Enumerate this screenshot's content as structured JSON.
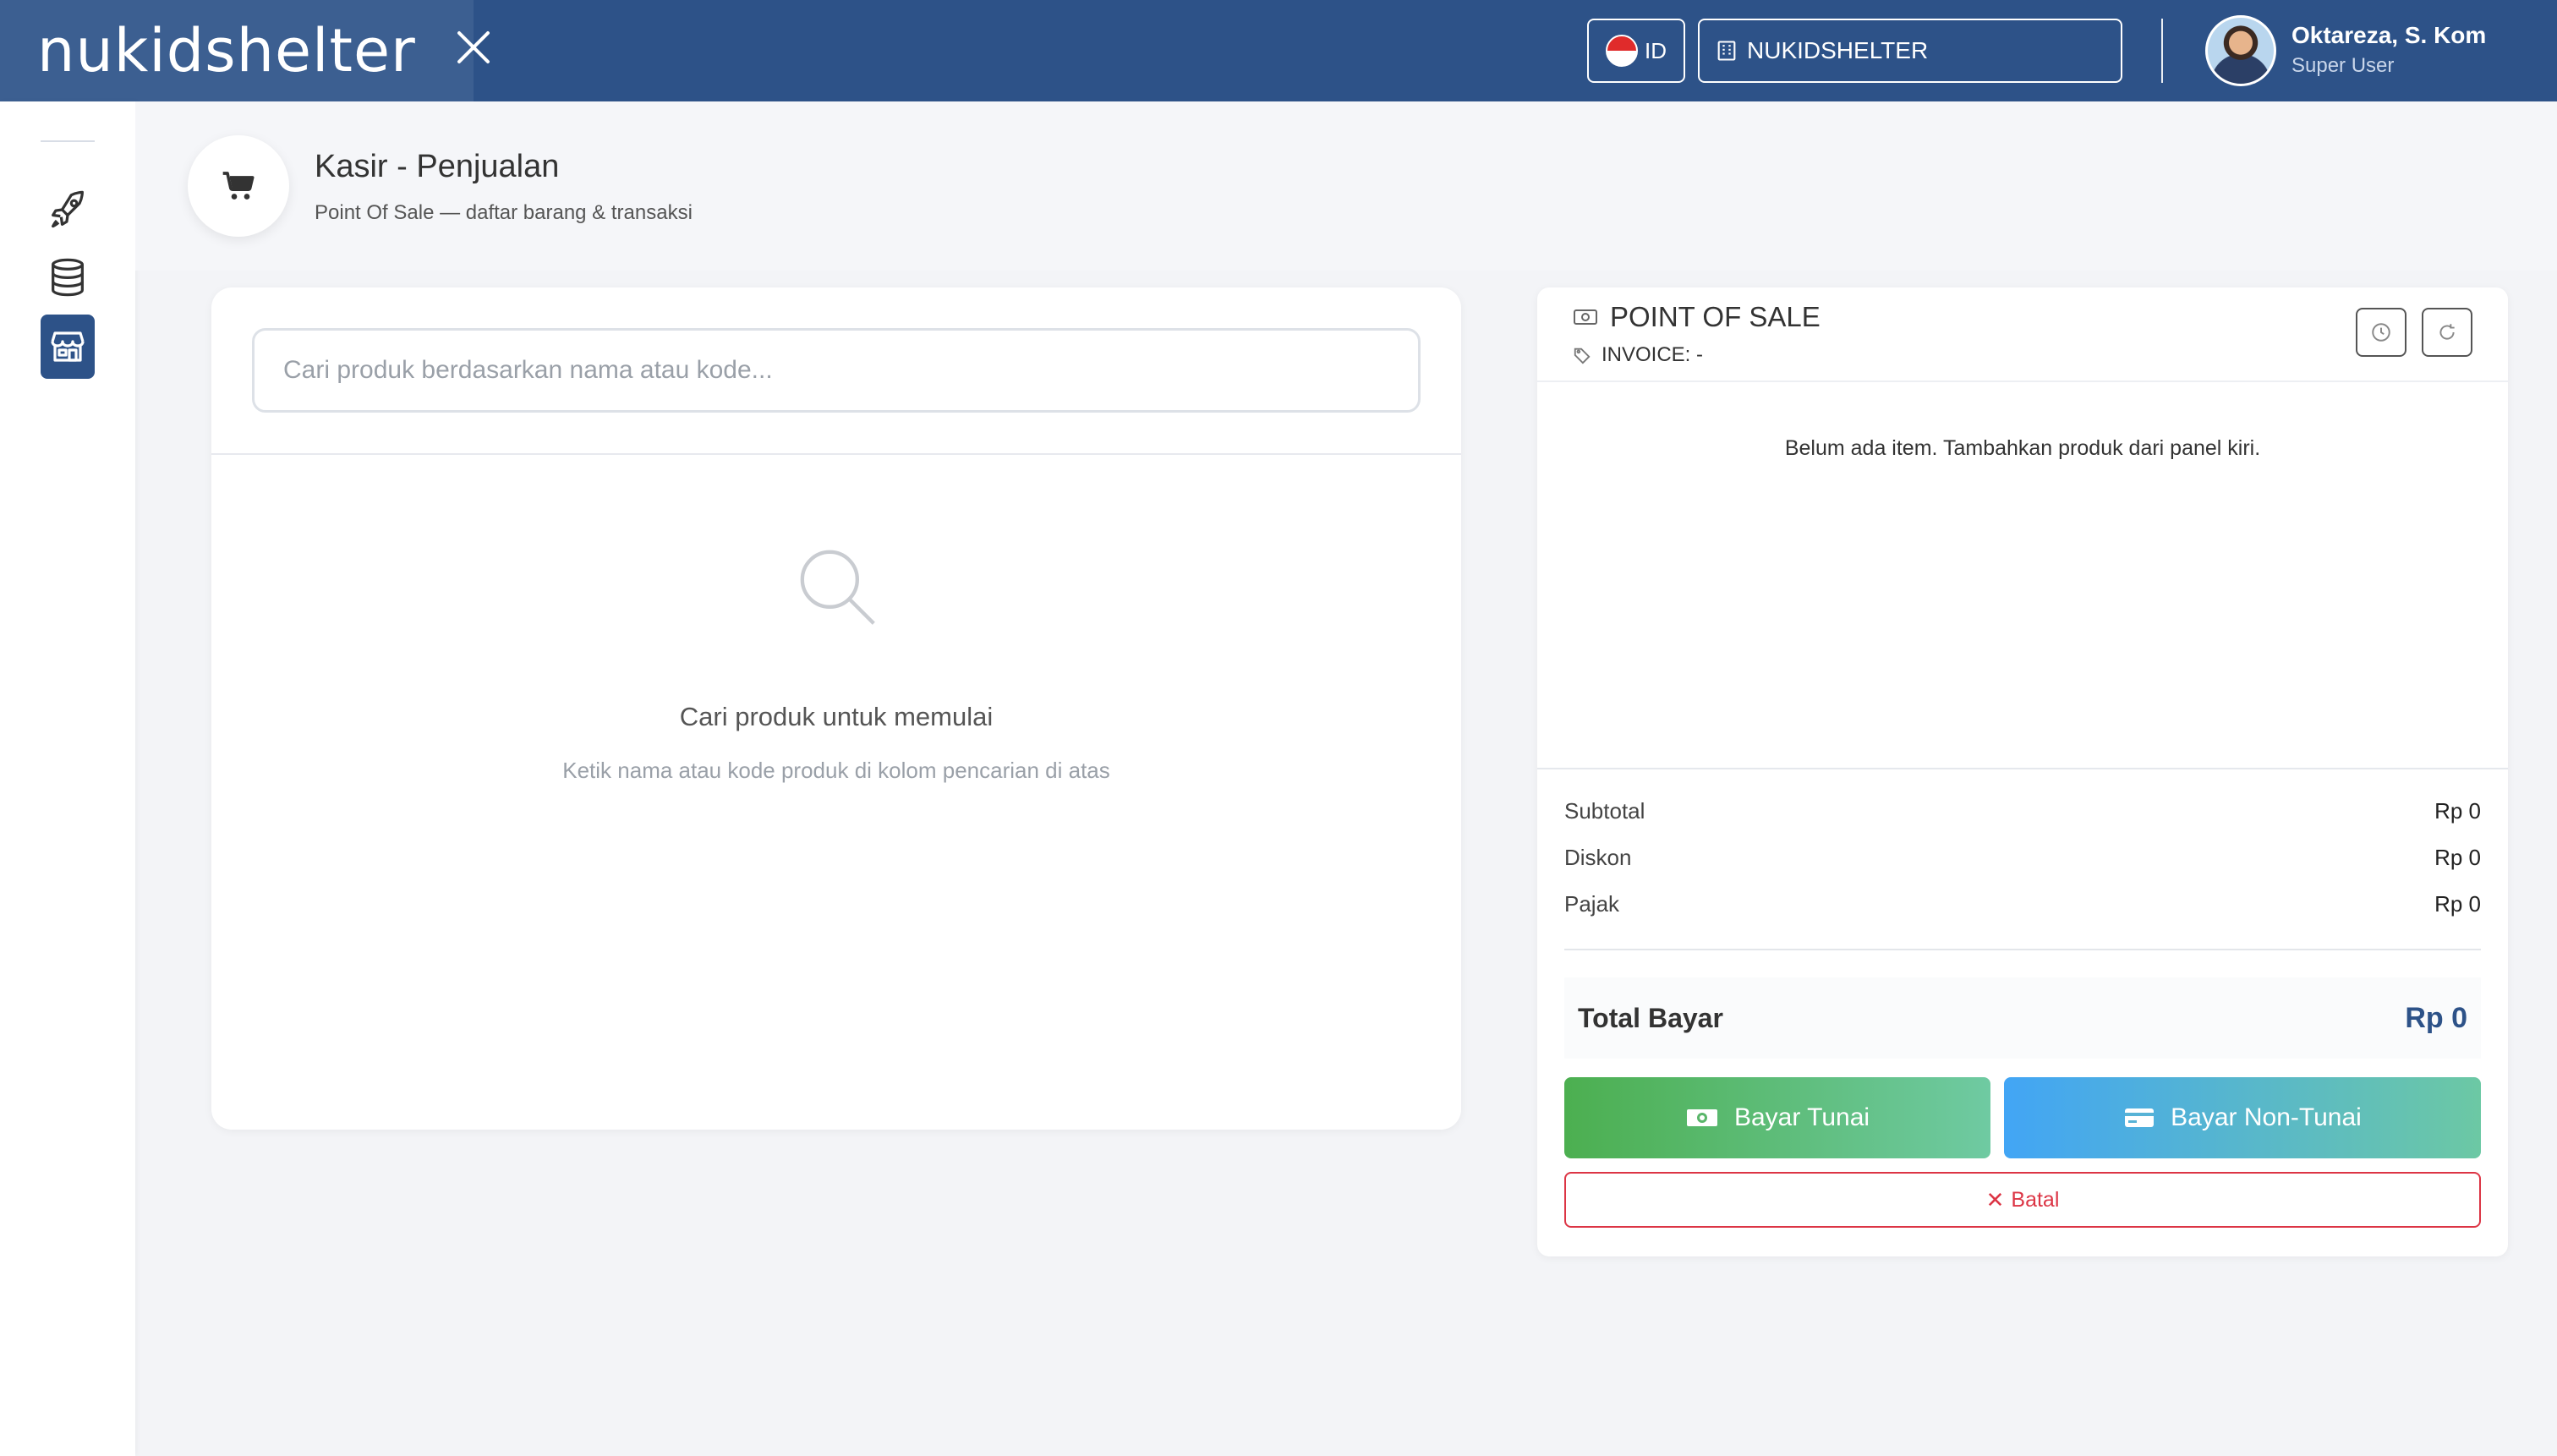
{
  "topbar": {
    "brand": "nukidshelter",
    "lang_code": "ID",
    "organization": "NUKIDSHELTER",
    "user_name": "Oktareza, S. Kom",
    "user_role": "Super User",
    "brand_color": "#2d5288"
  },
  "sidebar": {
    "items": [
      {
        "icon": "rocket-icon"
      },
      {
        "icon": "database-icon"
      },
      {
        "icon": "store-icon",
        "active": true
      }
    ]
  },
  "page": {
    "title": "Kasir - Penjualan",
    "subtitle": "Point Of Sale — daftar barang & transaksi"
  },
  "search": {
    "placeholder": "Cari produk berdasarkan nama atau kode...",
    "value": "",
    "empty_title": "Cari produk untuk memulai",
    "empty_subtitle": "Ketik nama atau kode produk di kolom pencarian di atas"
  },
  "pos": {
    "title": "POINT OF SALE",
    "invoice": "INVOICE: -",
    "empty_cart": "Belum ada item. Tambahkan produk dari panel kiri.",
    "subtotal_label": "Subtotal",
    "subtotal_value": "Rp 0",
    "discount_label": "Diskon",
    "discount_value": "Rp 0",
    "tax_label": "Pajak",
    "tax_value": "Rp 0",
    "total_label": "Total Bayar",
    "total_value": "Rp 0",
    "pay_cash_label": "Bayar Tunai",
    "pay_noncash_label": "Bayar Non-Tunai",
    "cancel_label": "Batal",
    "cancel_color": "#dc3545"
  }
}
